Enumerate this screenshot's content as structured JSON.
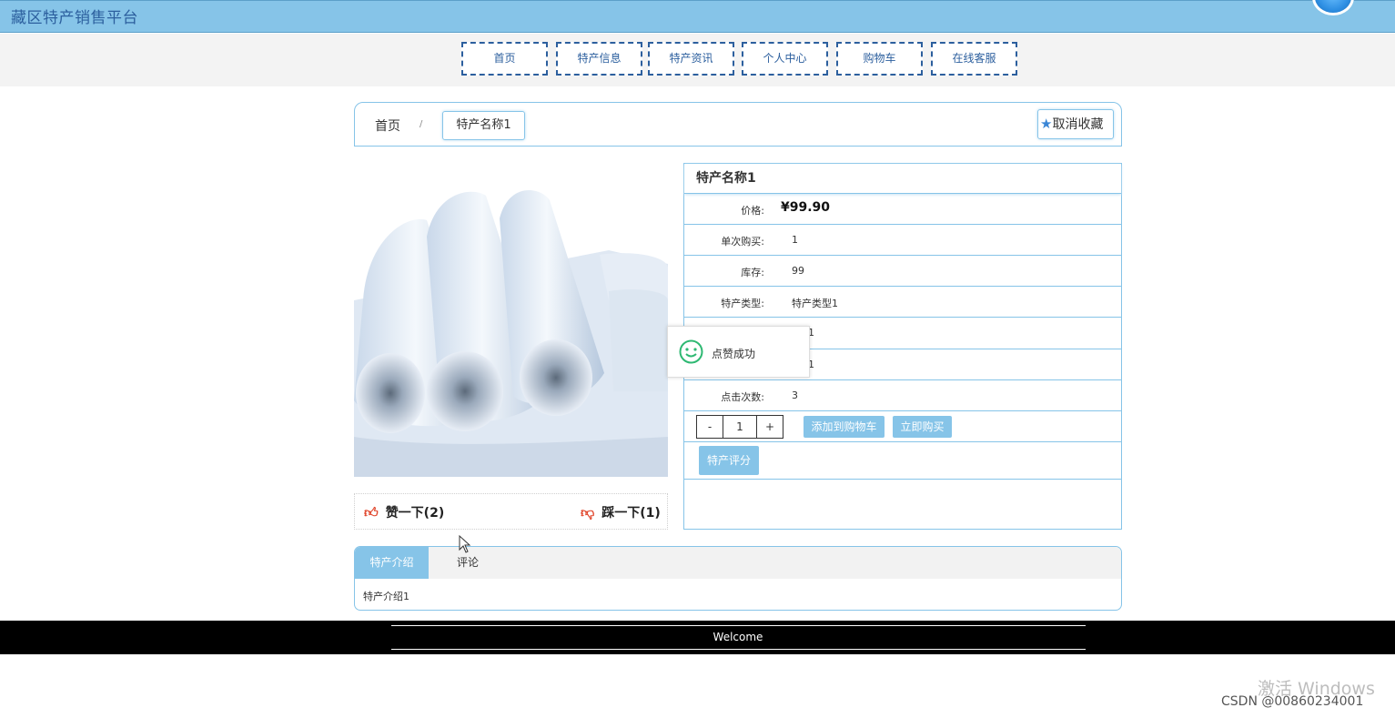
{
  "site": {
    "title": "藏区特产销售平台"
  },
  "nav": {
    "items": [
      "首页",
      "特产信息",
      "特产资讯",
      "个人中心",
      "购物车",
      "在线客服"
    ]
  },
  "breadcrumb": {
    "home": "首页",
    "separator": "/",
    "current": "特产名称1"
  },
  "favorite": {
    "label": "取消收藏",
    "icon": "star-icon"
  },
  "product": {
    "name": "特产名称1",
    "price_label": "价格:",
    "price": "¥99.90",
    "fields": [
      {
        "label": "单次购买:",
        "value": "1"
      },
      {
        "label": "库存:",
        "value": "99"
      },
      {
        "label": "特产类型:",
        "value": "特产类型1"
      },
      {
        "label": "",
        "value": "1"
      },
      {
        "label": "",
        "value": "1"
      },
      {
        "label": "点击次数:",
        "value": "3"
      }
    ],
    "quantity": {
      "minus": "-",
      "value": "1",
      "plus": "+"
    },
    "add_to_cart": "添加到购物车",
    "buy_now": "立即购买",
    "rate": "特产评分"
  },
  "votes": {
    "like": "赞一下(2)",
    "dislike": "踩一下(1)"
  },
  "toast": {
    "message": "点赞成功",
    "icon": "smile-icon"
  },
  "tabs": {
    "items": [
      "特产介绍",
      "评论"
    ],
    "active": 0,
    "content": "特产介绍1"
  },
  "footer": {
    "text": "Welcome"
  },
  "watermark": {
    "line1": "激活 Windows",
    "line2": "CSDN @00860234001"
  },
  "colors": {
    "accent": "#86c4e8",
    "brand_text": "#2c5f9e",
    "like": "#e0452b"
  }
}
